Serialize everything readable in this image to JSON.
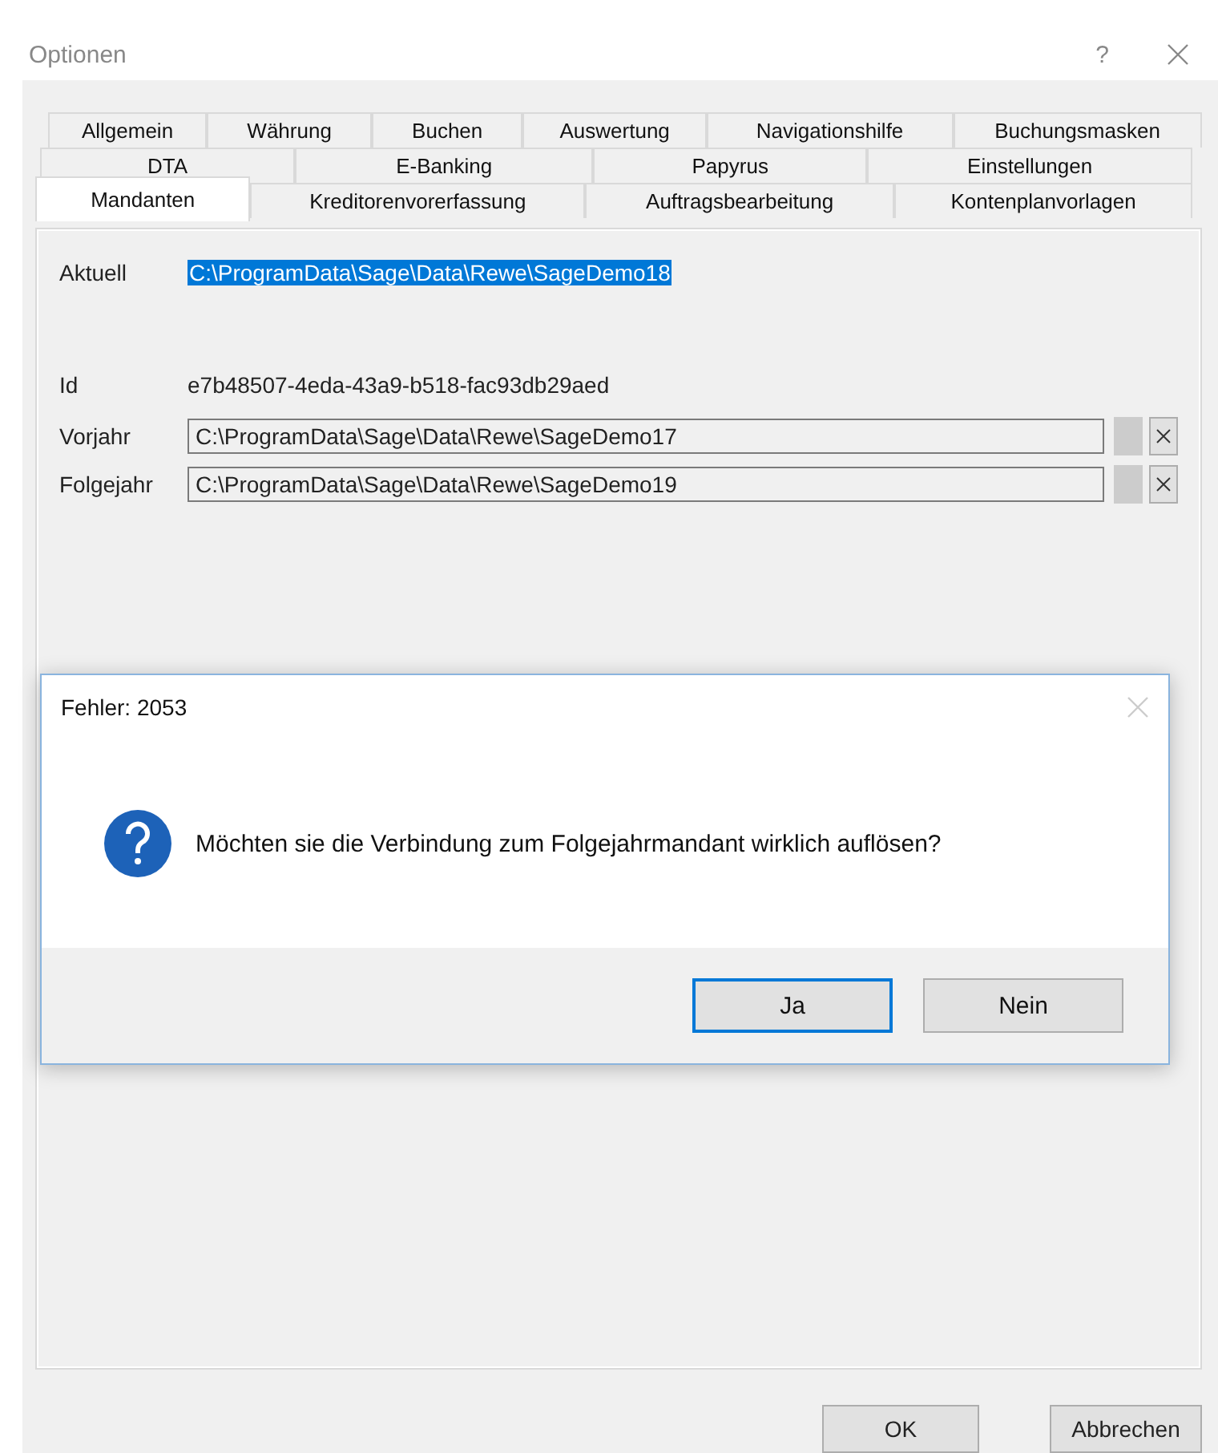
{
  "window": {
    "title": "Optionen",
    "help": "?"
  },
  "tab_rows": [
    [
      {
        "label": "Allgemein",
        "selected": false
      },
      {
        "label": "Währung",
        "selected": false
      },
      {
        "label": "Buchen",
        "selected": false
      },
      {
        "label": "Auswertung",
        "selected": false
      },
      {
        "label": "Navigationshilfe",
        "selected": false
      },
      {
        "label": "Buchungsmasken",
        "selected": false
      }
    ],
    [
      {
        "label": "DTA",
        "selected": false
      },
      {
        "label": "E-Banking",
        "selected": false
      },
      {
        "label": "Papyrus",
        "selected": false
      },
      {
        "label": "Einstellungen",
        "selected": false
      }
    ],
    [
      {
        "label": "Mandanten",
        "selected": true
      },
      {
        "label": "Kreditorenvorerfassung",
        "selected": false
      },
      {
        "label": "Auftragsbearbeitung",
        "selected": false
      },
      {
        "label": "Kontenplanvorlagen",
        "selected": false
      }
    ]
  ],
  "current": {
    "label": "Aktuell",
    "value": "C:\\ProgramData\\Sage\\Data\\Rewe\\SageDemo18",
    "selected": true
  },
  "id": {
    "label": "Id",
    "value": "e7b48507-4eda-43a9-b518-fac93db29aed"
  },
  "fields": [
    {
      "label": "Vorjahr",
      "value": "C:\\ProgramData\\Sage\\Data\\Rewe\\SageDemo17"
    },
    {
      "label": "Folgejahr",
      "value": "C:\\ProgramData\\Sage\\Data\\Rewe\\SageDemo19"
    }
  ],
  "dialog": {
    "title": "Fehler: 2053",
    "message": "Möchten sie die Verbindung zum Folgejahrmandant wirklich auflösen?",
    "buttons": [
      {
        "label": "Ja",
        "default": true
      },
      {
        "label": "Nein",
        "default": false
      }
    ]
  },
  "buttons": [
    "OK",
    "Abbrechen"
  ]
}
